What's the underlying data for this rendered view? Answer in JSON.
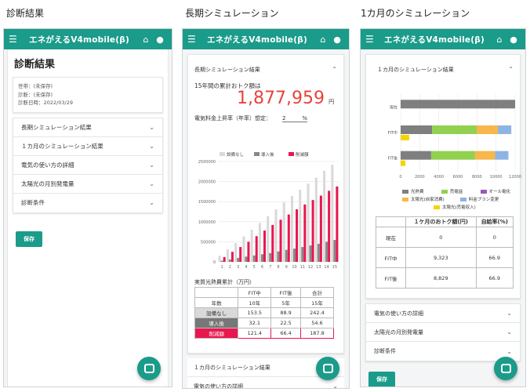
{
  "captions": [
    "診断結果",
    "長期シミュレーション",
    "1カ月のシミュレーション"
  ],
  "app": {
    "title": "エネがえるV4mobile(β)",
    "brand_color": "#1b9b8a"
  },
  "screen1": {
    "heading": "診断結果",
    "info_lines": [
      "世帯：(未保存)",
      "診断：(未保存)",
      "診断日時：2022/03/29"
    ],
    "accordions": [
      "長期シミュレーション結果",
      "１カ月のシミュレーション結果",
      "電気の使い方の詳細",
      "太陽光の月別発電量",
      "診断条件"
    ],
    "save_label": "保存"
  },
  "screen2": {
    "section_title": "長期シミュレーション結果",
    "total_label": "15年間の累計おトク額は",
    "total_value": "1,877,959",
    "total_unit": "円",
    "rate_label": "電気料金上昇率（年率）想定：",
    "rate_value": "2",
    "rate_unit": "%",
    "table_title": "実質光熱費累計（万円）",
    "table_headers": [
      "",
      "FIT中",
      "FIT後",
      "合計"
    ],
    "table_rows": [
      [
        "年数",
        "10年",
        "5年",
        "15年"
      ],
      [
        "設備なし",
        "153.5",
        "88.9",
        "242.4"
      ],
      [
        "導入後",
        "32.1",
        "22.5",
        "54.6"
      ],
      [
        "削減額",
        "121.4",
        "66.4",
        "187.8"
      ]
    ],
    "footer_rows": [
      "１カ月のシミュレーション結果",
      "電気の使い方の詳細"
    ]
  },
  "chart_data": [
    {
      "type": "bar",
      "title": "",
      "categories": [
        "1",
        "2",
        "3",
        "4",
        "5",
        "6",
        "7",
        "8",
        "9",
        "10",
        "11",
        "12",
        "13",
        "14",
        "15"
      ],
      "series": [
        {
          "name": "設備なし",
          "values": [
            150000,
            310000,
            470000,
            630000,
            800000,
            970000,
            1140000,
            1310000,
            1480000,
            1640000,
            1800000,
            1950000,
            2100000,
            2270000,
            2420000
          ],
          "color": "#d9d9d9"
        },
        {
          "name": "導入後",
          "values": [
            30000,
            60000,
            100000,
            130000,
            160000,
            190000,
            220000,
            260000,
            300000,
            330000,
            370000,
            410000,
            450000,
            500000,
            546000
          ],
          "color": "#888888"
        },
        {
          "name": "削減額",
          "values": [
            120000,
            250000,
            370000,
            500000,
            640000,
            780000,
            920000,
            1050000,
            1180000,
            1310000,
            1430000,
            1540000,
            1650000,
            1770000,
            1878000
          ],
          "color": "#e8174f"
        }
      ],
      "ylim": [
        0,
        2500000
      ],
      "yticks": [
        "2500000",
        "2000000",
        "1500000",
        "1000000",
        "500000",
        "0"
      ],
      "legend": "top"
    },
    {
      "type": "bar",
      "title": "",
      "orientation": "horizontal",
      "categories": [
        "現在",
        "FIT中",
        "FIT後"
      ],
      "series": [
        {
          "name": "光熱費",
          "values": [
            12000,
            3300,
            3200
          ],
          "color": "#7f7f7f"
        },
        {
          "name": "売電益",
          "values": [
            0,
            4700,
            4600
          ],
          "color": "#92d050"
        },
        {
          "name": "オール電化",
          "values": [
            0,
            0,
            0
          ],
          "color": "#9b59b6"
        },
        {
          "name": "太陽光(自家消費)",
          "values": [
            0,
            2200,
            2100
          ],
          "color": "#f7b74a"
        },
        {
          "name": "料金プラン変更",
          "values": [
            0,
            1400,
            1400
          ],
          "color": "#8db4e2"
        },
        {
          "name": "太陽光(売電収入)",
          "values": [
            0,
            900,
            500
          ],
          "color": "#f5d400"
        }
      ],
      "xlim": [
        0,
        12000
      ],
      "xticks": [
        "0",
        "2000",
        "4000",
        "6000",
        "8000",
        "10000",
        "12000"
      ],
      "legend": "bottom"
    }
  ],
  "screen3": {
    "section_title": "１カ月のシミュレーション結果",
    "legend_labels": [
      "光熱費",
      "売電益",
      "オール電化",
      "太陽光(自家消費)",
      "料金プラン変更",
      "太陽光(売電収入)"
    ],
    "legend_colors": [
      "#7f7f7f",
      "#92d050",
      "#9b59b6",
      "#f7b74a",
      "#8db4e2",
      "#f5d400"
    ],
    "table_headers": [
      "",
      "１ケ月のおトク額(円)",
      "自給率(%)"
    ],
    "table_rows": [
      [
        "現在",
        "0",
        "0"
      ],
      [
        "FIT中",
        "9,323",
        "66.9"
      ],
      [
        "FIT後",
        "8,829",
        "66.9"
      ]
    ],
    "accordions": [
      "電気の使い方の詳細",
      "太陽光の月別発電量",
      "診断条件"
    ],
    "save_label": "保存"
  }
}
